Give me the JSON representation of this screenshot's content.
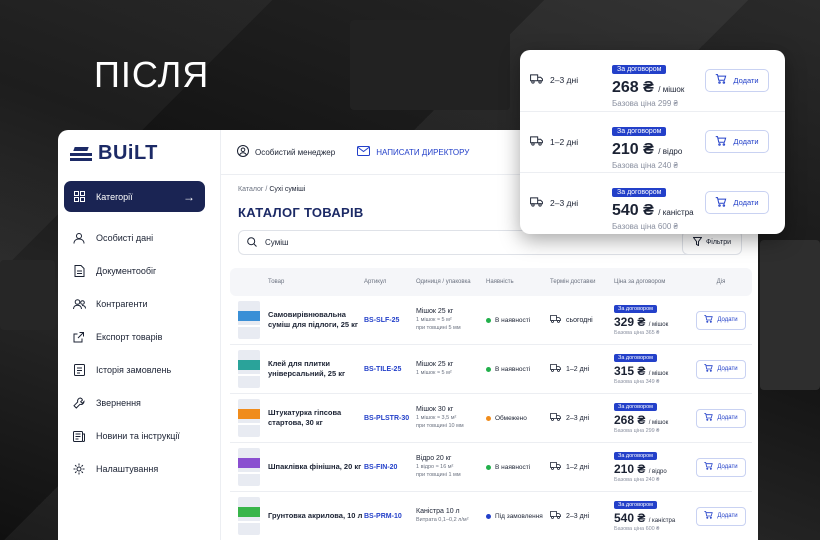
{
  "heading": "ПІСЛЯ",
  "brand": {
    "name": "BUiLT"
  },
  "sidebar": {
    "items": [
      {
        "label": "Категорії",
        "icon": "grid-icon",
        "active": true
      },
      {
        "label": "Особисті дані",
        "icon": "user-icon"
      },
      {
        "label": "Документообіг",
        "icon": "document-icon"
      },
      {
        "label": "Контрагенти",
        "icon": "users-icon"
      },
      {
        "label": "Експорт товарів",
        "icon": "export-icon"
      },
      {
        "label": "Історія замовлень",
        "icon": "list-icon"
      },
      {
        "label": "Звернення",
        "icon": "wrench-icon"
      },
      {
        "label": "Новини та інструкції",
        "icon": "news-icon"
      },
      {
        "label": "Налаштування",
        "icon": "gear-icon"
      }
    ]
  },
  "topbar": {
    "manager": "Особистий менеджер",
    "write_director": "НАПИСАТИ ДИРЕКТОРУ"
  },
  "breadcrumb": {
    "root": "Каталог",
    "separator": "/",
    "current": "Сухі суміші"
  },
  "page_title": "КАТАЛОГ ТОВАРІВ",
  "search": {
    "value": "Суміш"
  },
  "filters_label": "Фільтри",
  "table": {
    "headers": [
      "Товар",
      "Артикул",
      "Одиниця / упаковка",
      "Наявність",
      "Термін доставки",
      "Ціна за договором",
      "Дія"
    ],
    "rows": [
      {
        "name": "Самовирівнювальна суміш для підлоги, 25 кг",
        "article": "BS-SLF-25",
        "unit": "Мішок 25 кг",
        "unit_note1": "1 мішок ≈ 5 м²",
        "unit_note2": "при товщині 5 мм",
        "stock": "В наявності",
        "stock_color": "#22b04b",
        "delivery": "сьогодні",
        "badge": "За договором",
        "price": "329 ₴",
        "price_unit": "/ мішок",
        "base": "Базова ціна 365 ₴",
        "action": "Додати",
        "swatch": "#3a8fd6"
      },
      {
        "name": "Клей для плитки універсальний, 25 кг",
        "article": "BS-TILE-25",
        "unit": "Мішок 25 кг",
        "unit_note1": "1 мішок ≈ 5 м²",
        "unit_note2": "",
        "stock": "В наявності",
        "stock_color": "#22b04b",
        "delivery": "1–2 дні",
        "badge": "За договором",
        "price": "315 ₴",
        "price_unit": "/ мішок",
        "base": "Базова ціна 349 ₴",
        "action": "Додати",
        "swatch": "#2aa39a"
      },
      {
        "name": "Штукатурка гіпсова стартова, 30 кг",
        "article": "BS-PLSTR-30",
        "unit": "Мішок 30 кг",
        "unit_note1": "1 мішок ≈ 3,5 м²",
        "unit_note2": "при товщині 10 мм",
        "stock": "Обмежено",
        "stock_color": "#f08c1c",
        "delivery": "2–3 дні",
        "badge": "За договором",
        "price": "268 ₴",
        "price_unit": "/ мішок",
        "base": "Базова ціна 299 ₴",
        "action": "Додати",
        "swatch": "#f08c1c"
      },
      {
        "name": "Шпаклівка фінішна, 20 кг",
        "article": "BS-FIN-20",
        "unit": "Відро 20 кг",
        "unit_note1": "1 відро ≈ 16 м²",
        "unit_note2": "при товщині 1 мм",
        "stock": "В наявності",
        "stock_color": "#22b04b",
        "delivery": "1–2 дні",
        "badge": "За договором",
        "price": "210 ₴",
        "price_unit": "/ відро",
        "base": "Базова ціна 240 ₴",
        "action": "Додати",
        "swatch": "#8a4fd0"
      },
      {
        "name": "Грунтовка акрилова, 10 л",
        "article": "BS-PRM-10",
        "unit": "Каністра 10 л",
        "unit_note1": "Витрата 0,1–0,2 л/м²",
        "unit_note2": "",
        "stock": "Під замовлення",
        "stock_color": "#2340c9",
        "delivery": "2–3 дні",
        "badge": "За договором",
        "price": "540 ₴",
        "price_unit": "/ каністра",
        "base": "Базова ціна 600 ₴",
        "action": "Додати",
        "swatch": "#38b54a"
      }
    ]
  },
  "card": {
    "rows": [
      {
        "delivery": "2–3 дні",
        "badge": "За договором",
        "price": "268 ₴",
        "price_unit": "/ мішок",
        "base": "Базова ціна 299 ₴",
        "action": "Додати"
      },
      {
        "delivery": "1–2 дні",
        "badge": "За договором",
        "price": "210 ₴",
        "price_unit": "/ відро",
        "base": "Базова ціна 240 ₴",
        "action": "Додати"
      },
      {
        "delivery": "2–3 дні",
        "badge": "За договором",
        "price": "540 ₴",
        "price_unit": "/ каністра",
        "base": "Базова ціна 600 ₴",
        "action": "Додати"
      }
    ]
  },
  "colors": {
    "navy": "#1a2453",
    "accent": "#2340c9"
  }
}
